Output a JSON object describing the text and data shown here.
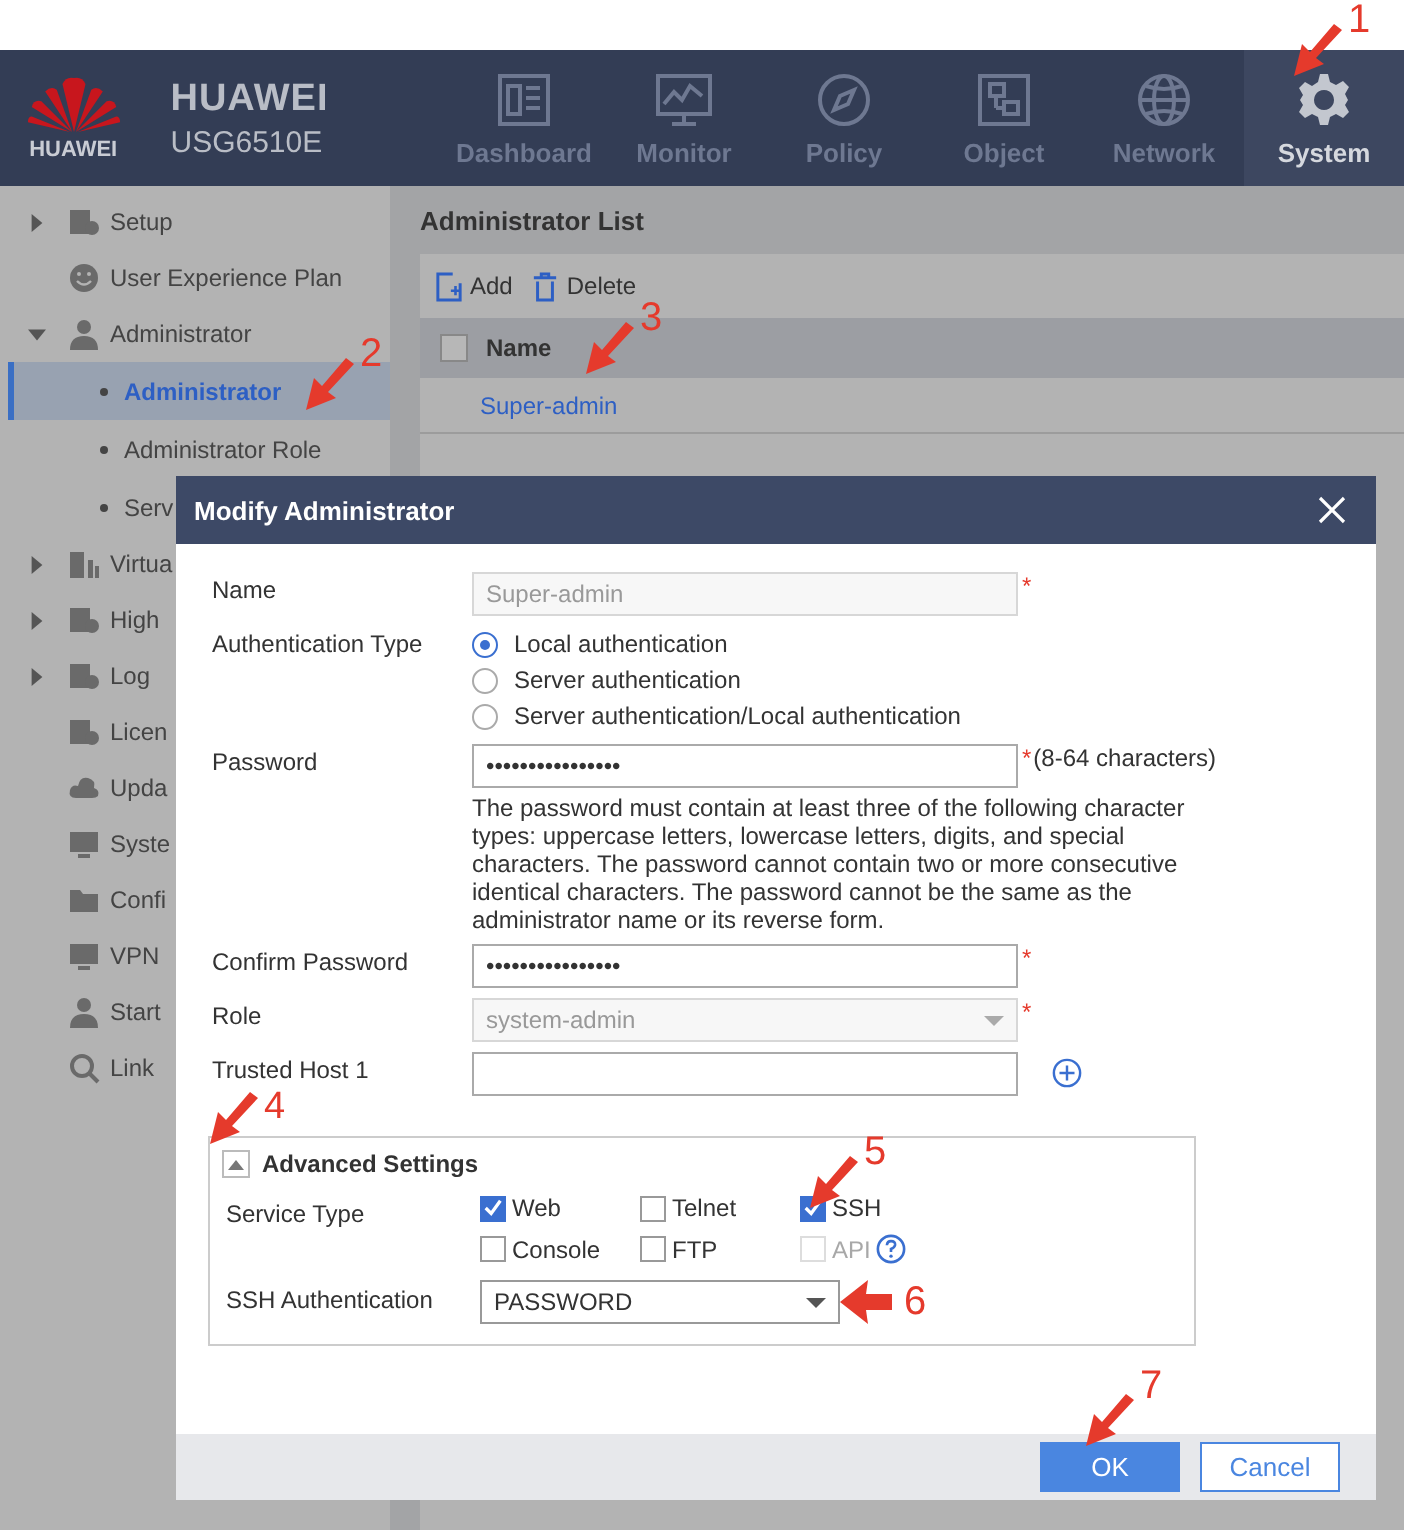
{
  "header": {
    "logo_text": "HUAWEI",
    "brand": "HUAWEI",
    "model": "USG6510E"
  },
  "nav": [
    {
      "label": "Dashboard",
      "selected": false
    },
    {
      "label": "Monitor",
      "selected": false
    },
    {
      "label": "Policy",
      "selected": false
    },
    {
      "label": "Object",
      "selected": false
    },
    {
      "label": "Network",
      "selected": false
    },
    {
      "label": "System",
      "selected": true,
      "callout": {
        "number": "1"
      }
    }
  ],
  "sidebar": {
    "items": [
      {
        "label": "Setup",
        "expanded": false
      },
      {
        "label": "User Experience Plan"
      },
      {
        "label": "Administrator",
        "expanded": true,
        "children": [
          {
            "label": "Administrator",
            "selected": true,
            "callout": {
              "number": "2"
            }
          },
          {
            "label": "Administrator Role",
            "selected": false
          },
          {
            "label": "Serv",
            "selected": false
          }
        ]
      },
      {
        "label": "Virtua",
        "expanded": false
      },
      {
        "label": "High",
        "expanded": false
      },
      {
        "label": "Log",
        "expanded": false
      },
      {
        "label": "Licen"
      },
      {
        "label": "Upda"
      },
      {
        "label": "Syste"
      },
      {
        "label": "Confi"
      },
      {
        "label": "VPN"
      },
      {
        "label": "Start"
      },
      {
        "label": "Link"
      }
    ]
  },
  "content": {
    "title": "Administrator List",
    "toolbar": [
      {
        "label": "Add",
        "kind": "add"
      },
      {
        "label": "Delete",
        "kind": "delete"
      }
    ],
    "table": {
      "header_checked": false,
      "columns": [
        "Name"
      ],
      "rows": [
        {
          "name": "Super-admin",
          "callout": {
            "number": "3"
          }
        }
      ]
    }
  },
  "dialog": {
    "title": "Modify Administrator",
    "fields": [
      {
        "kind": "text",
        "label": "Name",
        "value": "Super-admin",
        "disabled": true,
        "mark": "*"
      },
      {
        "kind": "radio",
        "label": "Authentication Type",
        "options": [
          {
            "label": "Local authentication",
            "selected": true
          },
          {
            "label": "Server authentication",
            "selected": false
          },
          {
            "label": "Server authentication/Local authentication",
            "selected": false
          }
        ]
      },
      {
        "kind": "password",
        "label": "Password",
        "value": "••••••••••••••••",
        "mark": "*",
        "note": "(8-64 characters)",
        "hint": "The password must contain at least three of the following character types: uppercase letters, lowercase letters, digits, and special characters. The password cannot contain two or more consecutive identical characters. The password cannot be the same as the administrator name or its reverse form."
      },
      {
        "kind": "password",
        "label": "Confirm Password",
        "value": "••••••••••••••••",
        "mark": "*"
      },
      {
        "kind": "select",
        "label": "Role",
        "value": "system-admin",
        "disabled": true,
        "mark": "*"
      },
      {
        "kind": "text",
        "label": "Trusted Host 1",
        "disabled": false,
        "add": true
      }
    ],
    "advanced": {
      "title": "Advanced Settings",
      "expanded": true,
      "callout": {
        "number": "4"
      },
      "service_label": "Service Type",
      "services": [
        {
          "label": "Web",
          "checked": true,
          "disabled": false
        },
        {
          "label": "Telnet",
          "checked": false,
          "disabled": false
        },
        {
          "label": "SSH",
          "checked": true,
          "disabled": false,
          "callout": {
            "number": "5"
          }
        },
        {
          "label": "Console",
          "checked": false,
          "disabled": false
        },
        {
          "label": "FTP",
          "checked": false,
          "disabled": false
        },
        {
          "label": "API",
          "checked": false,
          "disabled": true,
          "help": true
        }
      ],
      "ssh_label": "SSH Authentication",
      "ssh_value": "PASSWORD",
      "ssh_callout": {
        "number": "6"
      }
    },
    "buttons": [
      {
        "label": "OK",
        "kind": "primary",
        "callout": {
          "number": "7"
        }
      },
      {
        "label": "Cancel",
        "kind": "secondary"
      }
    ]
  }
}
